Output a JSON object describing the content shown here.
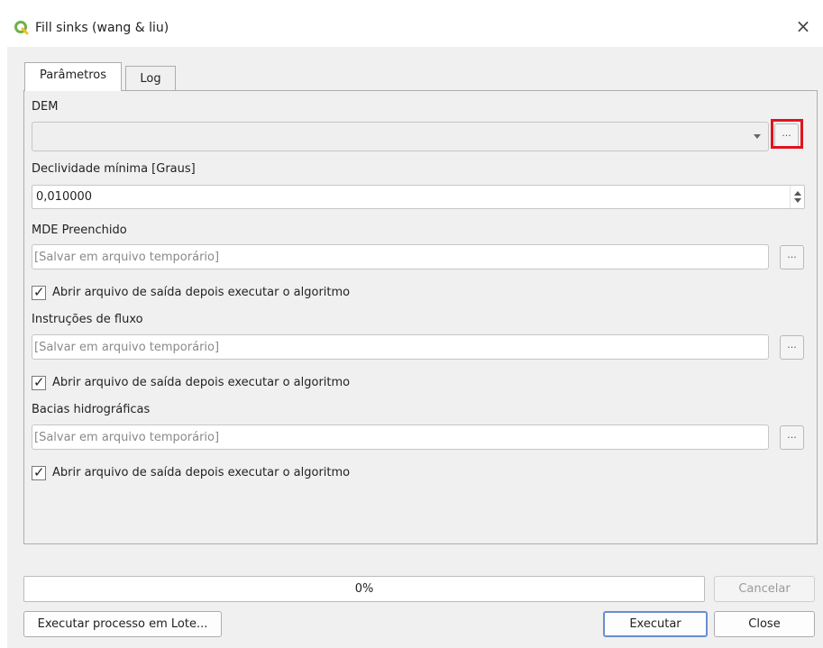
{
  "window": {
    "title": "Fill sinks (wang & liu)",
    "close_icon": "×"
  },
  "tabs": [
    {
      "label": "Parâmetros"
    },
    {
      "label": "Log"
    }
  ],
  "params": {
    "dem": {
      "label": "DEM",
      "value": "",
      "browse": "..."
    },
    "slope": {
      "label": "Declividade mínima [Graus]",
      "value": "0,010000"
    },
    "filled": {
      "label": "MDE Preenchido",
      "placeholder": "[Salvar em arquivo temporário]",
      "browse": "...",
      "open_after": "Abrir arquivo de saída depois executar o algoritmo",
      "checked": true
    },
    "flow": {
      "label": "Instruções de fluxo",
      "placeholder": "[Salvar em arquivo temporário]",
      "browse": "...",
      "open_after": "Abrir arquivo de saída depois executar o algoritmo",
      "checked": true
    },
    "basins": {
      "label": "Bacias hidrográficas",
      "placeholder": "[Salvar em arquivo temporário]",
      "browse": "...",
      "open_after": "Abrir arquivo de saída depois executar o algoritmo",
      "checked": true
    }
  },
  "progress": {
    "text": "0%",
    "value": 0
  },
  "buttons": {
    "cancel": "Cancelar",
    "batch": "Executar processo em Lote...",
    "run": "Executar",
    "close": "Close"
  },
  "colors": {
    "highlight": "#e0141e",
    "qgis_green": "#6fb04a",
    "qgis_yellow": "#f3c020"
  },
  "icons": {
    "app": "qgis-logo-icon",
    "close": "close-icon",
    "dropdown": "chevron-down-icon",
    "check": "checkmark-icon"
  }
}
